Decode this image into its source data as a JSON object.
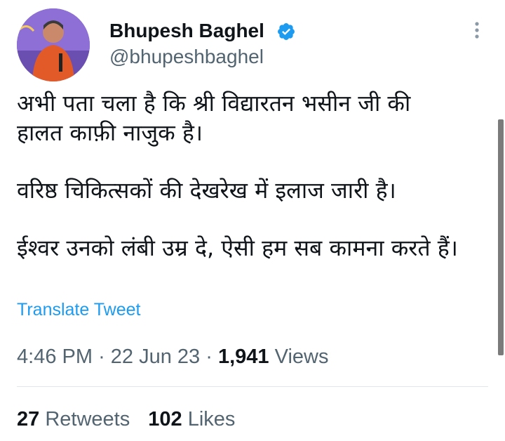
{
  "author": {
    "name": "Bhupesh Baghel",
    "handle": "@bhupeshbaghel",
    "verified_icon": "verified-badge-icon",
    "verified_color": "#1d9bf0"
  },
  "more_icon": "more-vertical-icon",
  "tweet": {
    "paragraphs": [
      {
        "lines": [
          "अभी पता चला है कि श्री विद्यारतन भसीन जी की",
          "हालत काफ़ी नाजुक है।"
        ]
      },
      {
        "lines": [
          "वरिष्ठ चिकित्सकों की देखरेख में इलाज जारी है।"
        ]
      },
      {
        "lines": [
          "ईश्वर उनको लंबी उम्र दे, ऐसी हम सब कामना करते हैं।"
        ]
      }
    ],
    "translate_label": "Translate Tweet",
    "time": "4:46 PM",
    "separator": "·",
    "date": "22 Jun 23",
    "views_count": "1,941",
    "views_label": "Views"
  },
  "stats": {
    "retweets_count": "27",
    "retweets_label": "Retweets",
    "likes_count": "102",
    "likes_label": "Likes"
  },
  "colors": {
    "link": "#1d9bf0",
    "secondary_text": "#536471",
    "primary_text": "#0f1419"
  }
}
